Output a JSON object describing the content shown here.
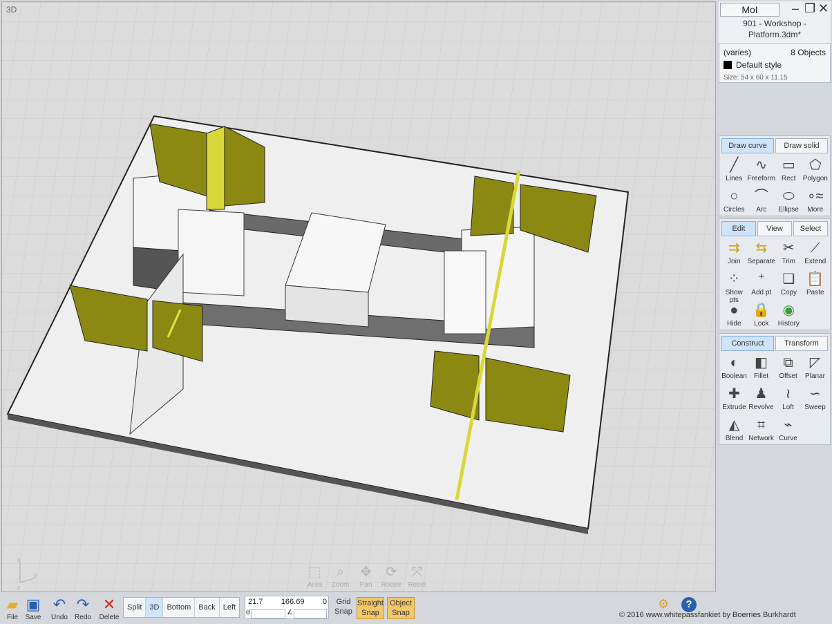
{
  "viewport": {
    "label": "3D"
  },
  "nav_tools": [
    {
      "label": "Area",
      "icon": "area-zoom-icon"
    },
    {
      "label": "Zoom",
      "icon": "zoom-icon"
    },
    {
      "label": "Pan",
      "icon": "pan-icon"
    },
    {
      "label": "Rotate",
      "icon": "rotate-icon"
    },
    {
      "label": "Reset",
      "icon": "reset-icon"
    }
  ],
  "axis": {
    "x": "x",
    "y": "y",
    "z": "z"
  },
  "title_panel": {
    "app_button": "MoI",
    "document": "901 - Workshop - Platform.3dm*"
  },
  "properties": {
    "name": "(varies)",
    "count": "8 Objects",
    "style": "Default style",
    "style_color": "#000000",
    "size": "Size:  54 x 60 x 11.15"
  },
  "draw_panel": {
    "tabs": [
      "Draw curve",
      "Draw solid"
    ],
    "tools": [
      "Lines",
      "Freeform",
      "Rect",
      "Polygon",
      "Circles",
      "Arc",
      "Ellipse",
      "More"
    ]
  },
  "edit_panel": {
    "tabs": [
      "Edit",
      "View",
      "Select"
    ],
    "tools": [
      "Join",
      "Separate",
      "Trim",
      "Extend",
      "Show pts",
      "Add pt",
      "Copy",
      "Paste",
      "Hide",
      "Lock",
      "History"
    ]
  },
  "construct_panel": {
    "tabs": [
      "Construct",
      "Transform"
    ],
    "tools": [
      "Boolean",
      "Fillet",
      "Offset",
      "Planar",
      "Extrude",
      "Revolve",
      "Loft",
      "Sweep",
      "Blend",
      "Network",
      "Curve"
    ]
  },
  "toolbar": {
    "file": "File",
    "save": "Save",
    "undo": "Undo",
    "redo": "Redo",
    "delete": "Delete"
  },
  "views": [
    "Split",
    "3D",
    "Bottom",
    "Back",
    "Left"
  ],
  "coords": {
    "x": "21.7",
    "y": "166.69",
    "z": "0",
    "d_label": "d",
    "angle_label": "∠"
  },
  "grid_snap": "Grid Snap",
  "straight_snap": "Straight Snap",
  "object_snap": "Object Snap",
  "copyright": "© 2016 www.whitepassfankiet by Boerries Burkhardt",
  "colors": {
    "accent_yellow": "#b7b31e",
    "active_tab": "#cfe3fb",
    "snap_on": "#f2c86a"
  }
}
